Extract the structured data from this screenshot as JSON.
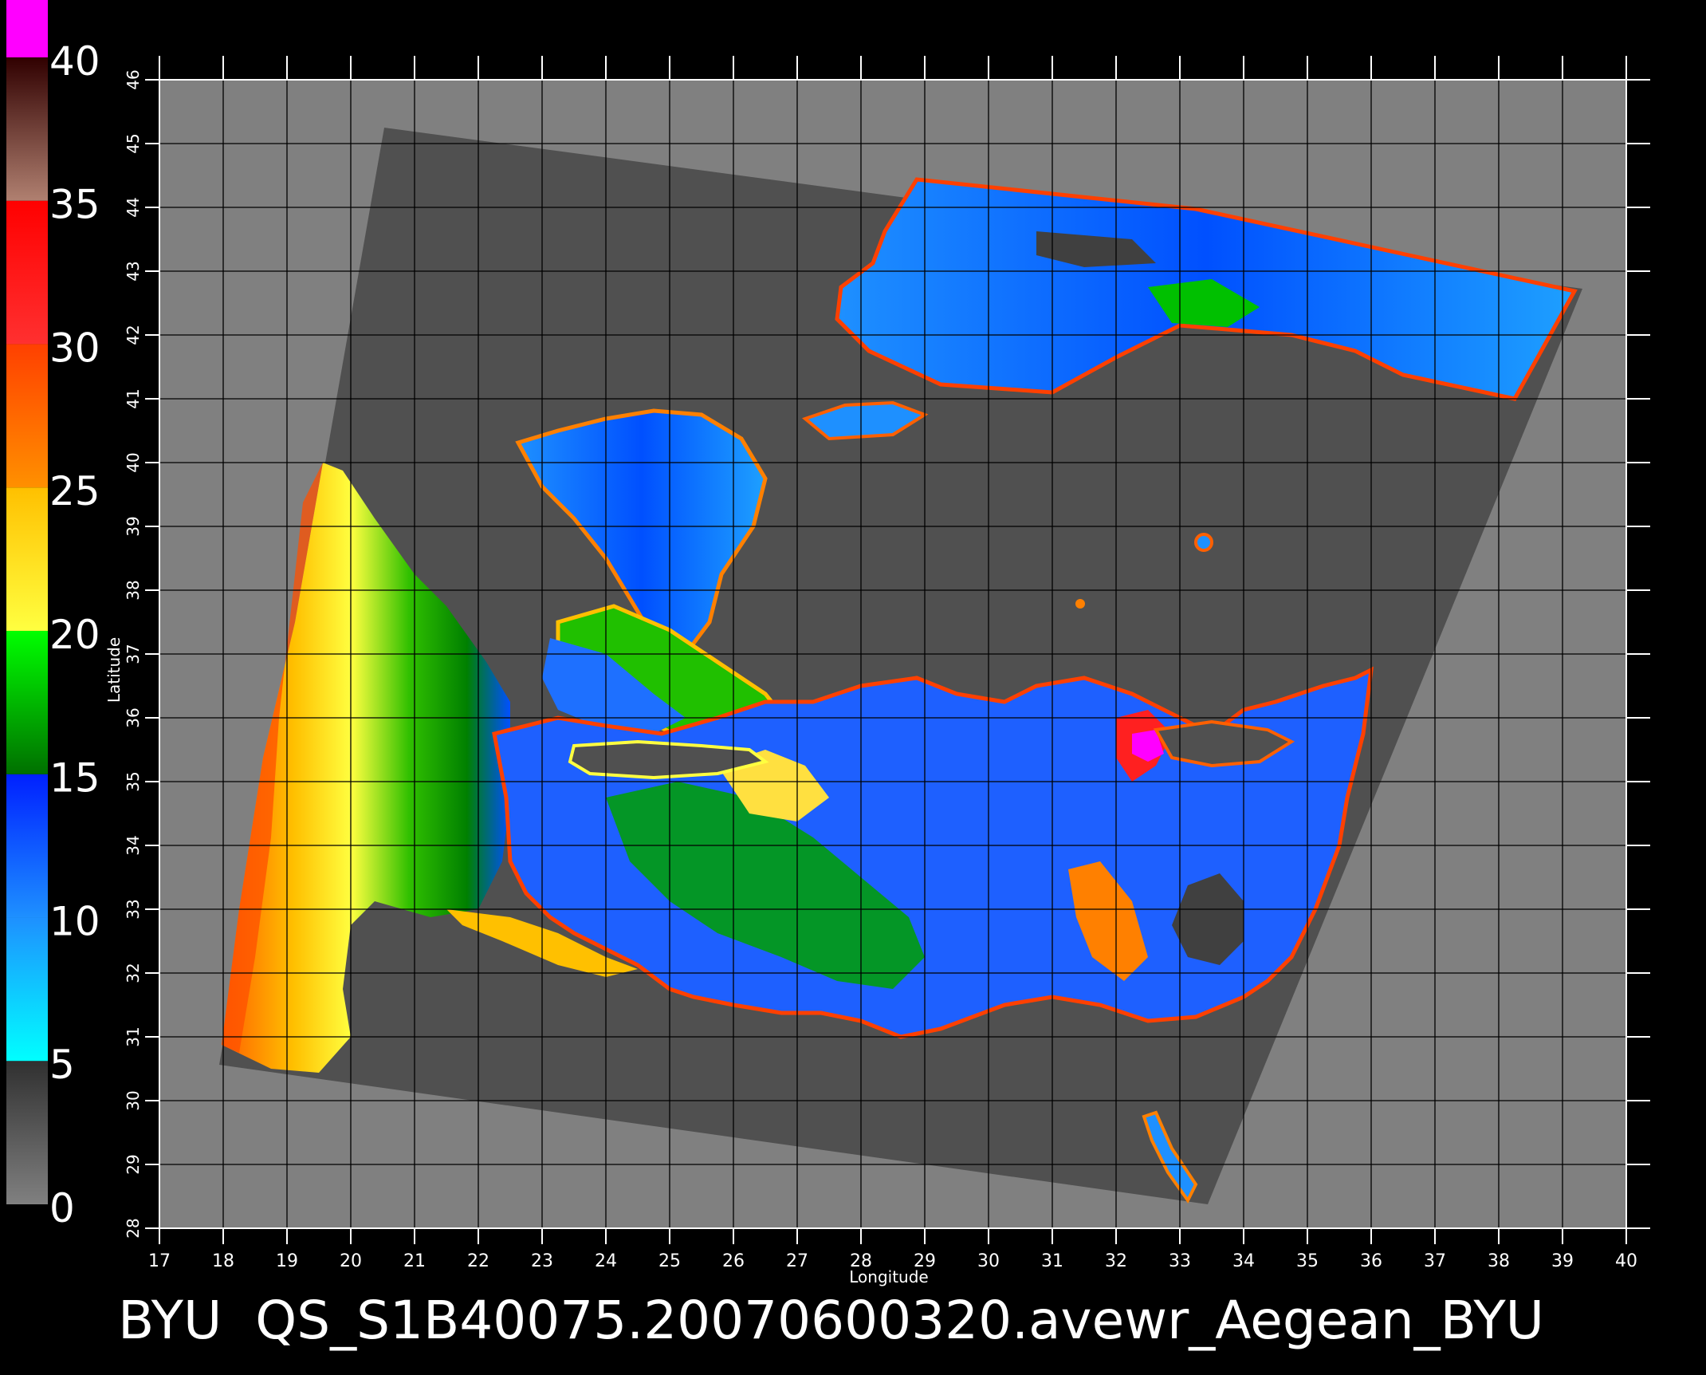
{
  "title": "BYU  QS_S1B40075.20070600320.avewr_Aegean_BYU",
  "axes": {
    "xlabel": "Longitude",
    "ylabel": "Latitude",
    "x_ticks": [
      "17",
      "18",
      "19",
      "20",
      "21",
      "22",
      "23",
      "24",
      "25",
      "26",
      "27",
      "28",
      "29",
      "30",
      "31",
      "32",
      "33",
      "34",
      "35",
      "36",
      "37",
      "38",
      "39",
      "40"
    ],
    "y_ticks": [
      "28",
      "29",
      "30",
      "31",
      "32",
      "33",
      "34",
      "35",
      "36",
      "37",
      "38",
      "39",
      "40",
      "41",
      "42",
      "43",
      "44",
      "45",
      "46"
    ],
    "xlim": [
      17,
      40
    ],
    "ylim": [
      28,
      46
    ],
    "grid": true
  },
  "colorbar": {
    "labels": [
      "0",
      "5",
      "10",
      "15",
      "20",
      "25",
      "30",
      "35",
      "40"
    ],
    "range": [
      0,
      40
    ],
    "bands": [
      {
        "from": 0,
        "to": 5,
        "colors": [
          "#808080",
          "#303030"
        ]
      },
      {
        "from": 5,
        "to": 10,
        "colors": [
          "#00ffff",
          "#1e90ff"
        ]
      },
      {
        "from": 10,
        "to": 15,
        "colors": [
          "#1e90ff",
          "#0020ff"
        ]
      },
      {
        "from": 15,
        "to": 20,
        "colors": [
          "#007000",
          "#00ff00"
        ]
      },
      {
        "from": 20,
        "to": 25,
        "colors": [
          "#ffff40",
          "#ffc000"
        ]
      },
      {
        "from": 25,
        "to": 30,
        "colors": [
          "#ff9000",
          "#ff4000"
        ]
      },
      {
        "from": 30,
        "to": 35,
        "colors": [
          "#ff3030",
          "#ff0000"
        ]
      },
      {
        "from": 35,
        "to": 40,
        "colors": [
          "#b08070",
          "#300000"
        ]
      },
      {
        "from": 40,
        "to": 42,
        "colors": [
          "#ff00ff",
          "#ff00ff"
        ]
      }
    ]
  },
  "colors": {
    "background": "#000000",
    "plot_area": "#808080",
    "swath": "#505050",
    "grid": "#000000",
    "text": "#ffffff"
  }
}
